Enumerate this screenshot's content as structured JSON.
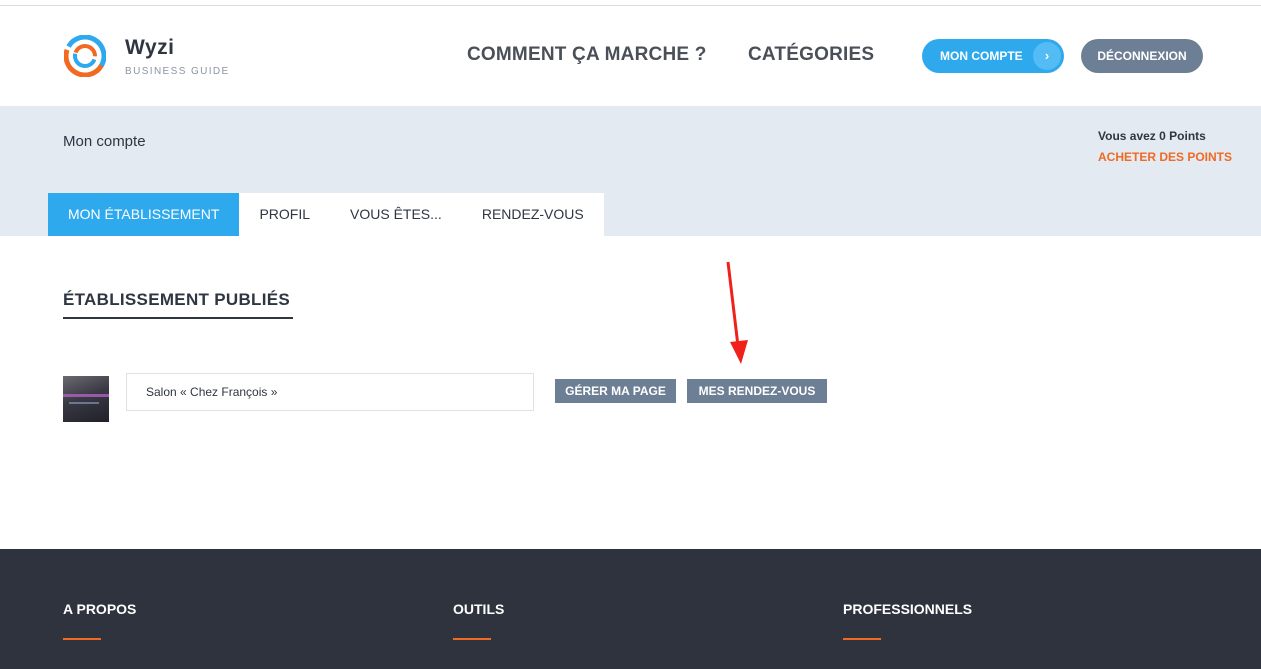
{
  "brand": {
    "name": "Wyzi",
    "tagline": "BUSINESS GUIDE"
  },
  "nav": {
    "how_it_works": "COMMENT ÇA MARCHE ?",
    "categories": "CATÉGORIES"
  },
  "header_buttons": {
    "account": "MON COMPTE",
    "account_chevron": "›",
    "logout": "DÉCONNEXION"
  },
  "account": {
    "title": "Mon compte",
    "points_text": "Vous avez 0 Points",
    "buy_points": "ACHETER DES POINTS",
    "tabs": [
      {
        "label": "MON ÉTABLISSEMENT",
        "active": true
      },
      {
        "label": "PROFIL",
        "active": false
      },
      {
        "label": "VOUS ÊTES...",
        "active": false
      },
      {
        "label": "RENDEZ-VOUS",
        "active": false
      }
    ]
  },
  "main": {
    "section_title": "ÉTABLISSEMENT PUBLIÉS",
    "listing": {
      "name": "Salon « Chez François »",
      "manage_button": "GÉRER MA PAGE",
      "appointments_button": "MES RENDEZ-VOUS"
    }
  },
  "footer": {
    "columns": [
      "A PROPOS",
      "OUTILS",
      "PROFESSIONNELS"
    ]
  },
  "colors": {
    "primary_blue": "#2fa9ee",
    "slate_button": "#6d7f94",
    "accent_orange": "#f06a22",
    "band_bg": "#e3eaf2",
    "footer_bg": "#2e333d",
    "annotation_arrow": "#f0211b"
  }
}
